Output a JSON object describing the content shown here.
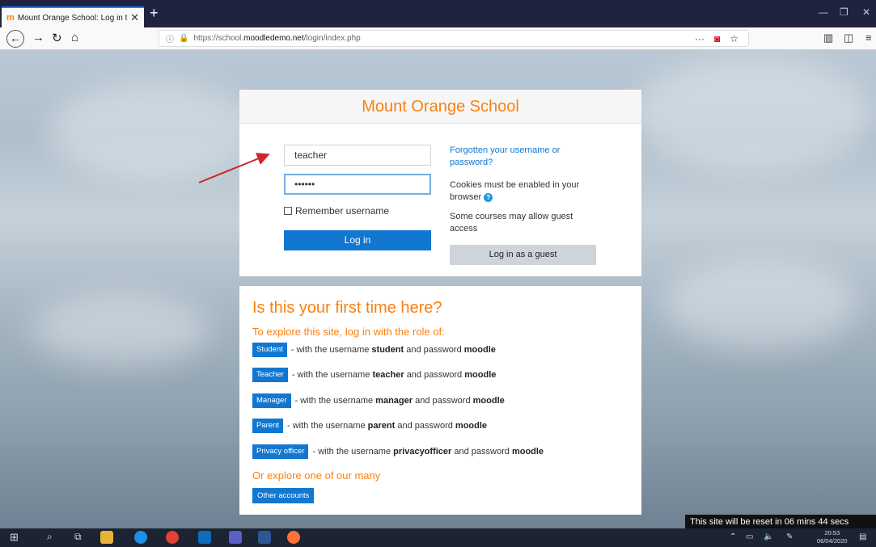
{
  "browser": {
    "tab_title": "Mount Orange School: Log in t",
    "tab_favicon": "moodle-favicon",
    "url_prefix": "https://school.",
    "url_domain": "moodledemo.net",
    "url_path": "/login/index.php",
    "url_actions": [
      "···",
      "pocket-icon",
      "star-icon"
    ]
  },
  "login": {
    "site_name": "Mount Orange School",
    "username_value": "teacher",
    "password_mask": "••••••",
    "remember_label": "Remember username",
    "login_button": "Log in",
    "forgot_link": "Forgotten your username or password?",
    "cookies_note": "Cookies must be enabled in your browser",
    "guest_note": "Some courses may allow guest access",
    "guest_button": "Log in as a guest"
  },
  "intro": {
    "heading": "Is this your first time here?",
    "explore_text": "To explore this site, log in with the role of:",
    "roles": [
      {
        "button": "Student",
        "pre": "- with the username",
        "username": "student",
        "mid": "and password",
        "password": "moodle"
      },
      {
        "button": "Teacher",
        "pre": "- with the username",
        "username": "teacher",
        "mid": "and password",
        "password": "moodle"
      },
      {
        "button": "Manager",
        "pre": "- with the username",
        "username": "manager",
        "mid": "and password",
        "password": "moodle"
      },
      {
        "button": "Parent",
        "pre": "- with the username",
        "username": "parent",
        "mid": "and password",
        "password": "moodle"
      },
      {
        "button": "Privacy officer",
        "pre": "- with the username",
        "username": "privacyofficer",
        "mid": "and password",
        "password": "moodle"
      }
    ],
    "explore_more": "Or explore one of our many",
    "other_button": "Other accounts"
  },
  "reset_notice": "This site will be reset in 06 mins 44 secs",
  "taskbar": {
    "time": "20:53",
    "date": "06/04/2020"
  },
  "colors": {
    "accent_orange": "#f98012",
    "primary_blue": "#1177d1",
    "arrow_red": "#d0262b"
  }
}
